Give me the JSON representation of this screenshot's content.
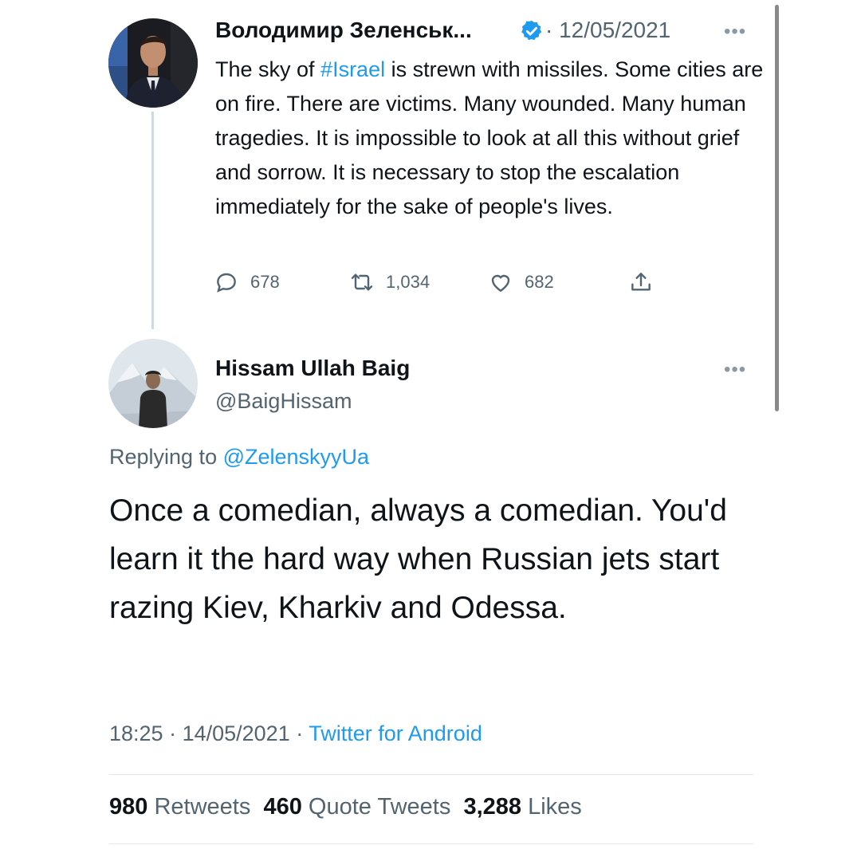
{
  "original_tweet": {
    "author_name": "Володимир Зеленськ...",
    "verified_icon": "verified-badge-icon",
    "date": "· 12/05/2021",
    "more_icon": "more-dots-icon",
    "body_before_hashtag": "The sky of ",
    "hashtag": "#Israel",
    "body_after_hashtag": " is strewn with missiles. Some cities are on fire. There are victims. Many wounded. Many human tragedies. It is impossible to look at all this without grief and sorrow. It is necessary to stop the escalation immediately for the sake of people's lives.",
    "replies": "678",
    "retweets": "1,034",
    "likes": "682"
  },
  "reply_tweet": {
    "author_name": "Hissam Ullah Baig",
    "handle": "@BaigHissam",
    "replying_prefix": "Replying to ",
    "replying_to": "@ZelenskyyUa",
    "text": "Once a comedian, always a comedian. You'd learn it the hard way when Russian jets start razing Kiev, Kharkiv and Odessa.",
    "time": "18:25",
    "date": "14/05/2021",
    "source": "Twitter for Android",
    "retweets_count": "980",
    "retweets_label": "Retweets",
    "quote_count": "460",
    "quote_label": "Quote Tweets",
    "likes_count": "3,288",
    "likes_label": "Likes"
  },
  "colors": {
    "link": "#1d9bf0",
    "secondary_text": "#536471",
    "primary_text": "#0f1419"
  }
}
